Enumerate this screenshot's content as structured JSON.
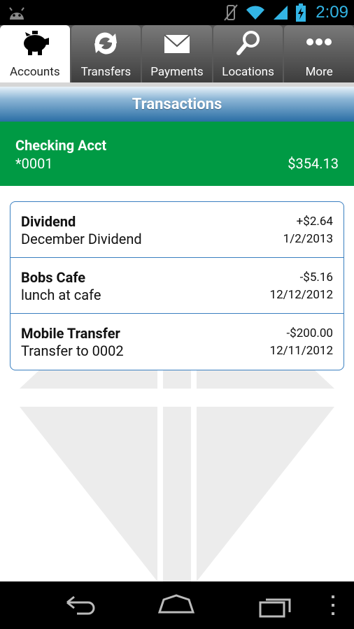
{
  "status": {
    "time": "2:09"
  },
  "tabs": [
    {
      "label": "Accounts",
      "icon": "piggy-bank-icon",
      "active": true
    },
    {
      "label": "Transfers",
      "icon": "refresh-arrows-icon",
      "active": false
    },
    {
      "label": "Payments",
      "icon": "envelope-icon",
      "active": false
    },
    {
      "label": "Locations",
      "icon": "magnifier-icon",
      "active": false
    },
    {
      "label": "More",
      "icon": "ellipsis-icon",
      "active": false
    }
  ],
  "header": {
    "title": "Transactions"
  },
  "account": {
    "name": "Checking Acct",
    "number": "*0001",
    "balance": "$354.13"
  },
  "transactions": [
    {
      "title": "Dividend",
      "description": "December Dividend",
      "amount": "+$2.64",
      "date": "1/2/2013"
    },
    {
      "title": "Bobs Cafe",
      "description": "lunch at cafe",
      "amount": "-$5.16",
      "date": "12/12/2012"
    },
    {
      "title": "Mobile Transfer",
      "description": "Transfer to 0002",
      "amount": "-$200.00",
      "date": "12/11/2012"
    }
  ],
  "colors": {
    "accent": "#33b5e5",
    "account_green": "#009a44",
    "list_border": "#3a7fc0"
  }
}
